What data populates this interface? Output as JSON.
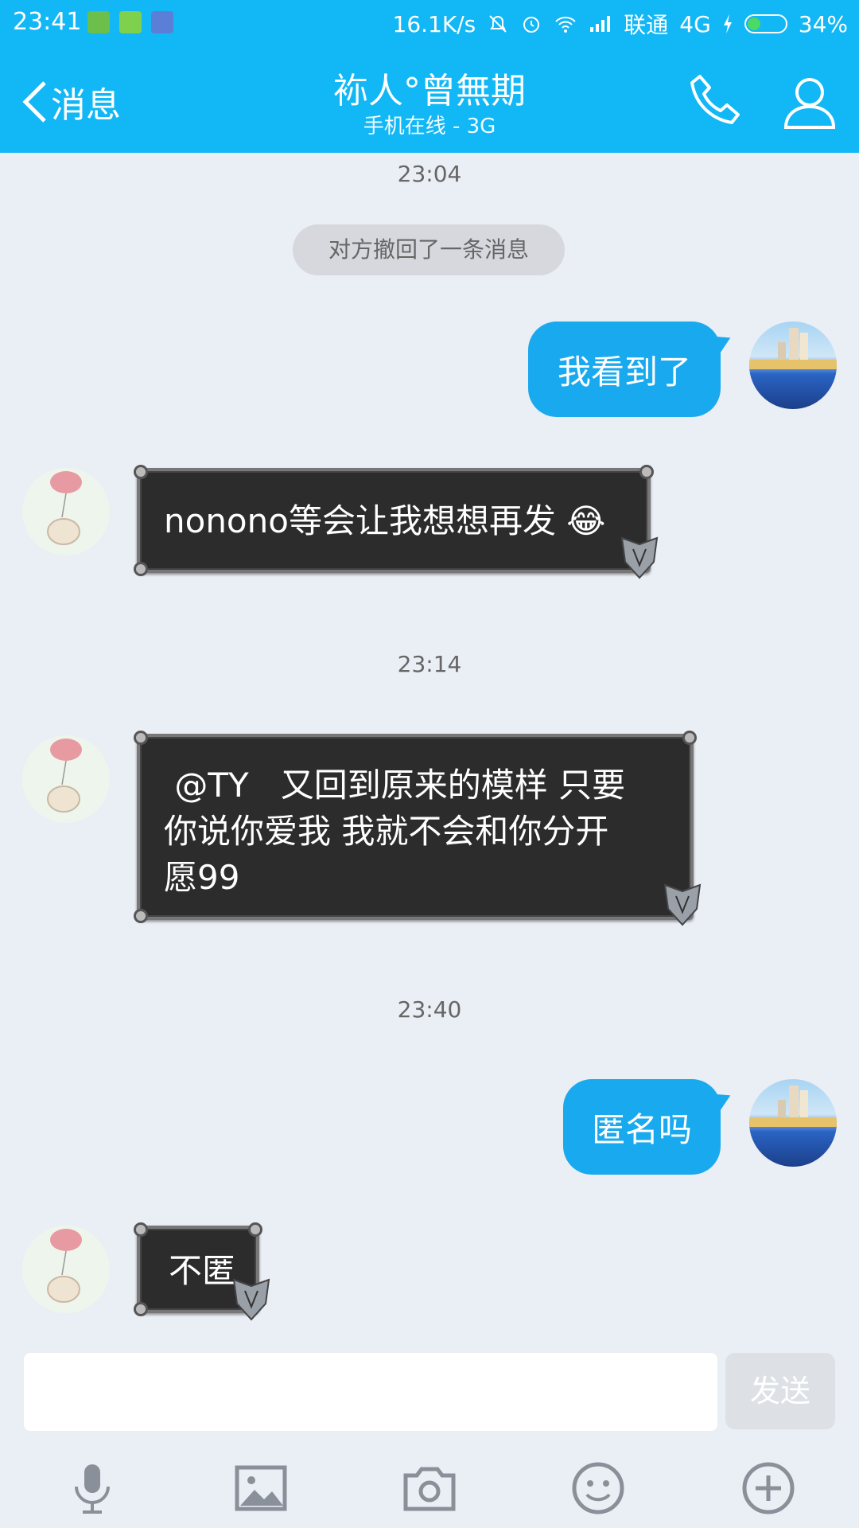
{
  "status": {
    "time": "23:41",
    "net_speed": "16.1K/s",
    "carrier": "联通",
    "network": "4G",
    "battery": "34%",
    "battery_level": 0.34
  },
  "header": {
    "back_label": "消息",
    "title": "袮人°曾無期",
    "subtitle": "手机在线 - 3G"
  },
  "chat": {
    "timestamps": [
      "23:04",
      "23:14",
      "23:40"
    ],
    "system_notice": "对方撤回了一条消息",
    "messages": [
      {
        "side": "out",
        "text": "我看到了"
      },
      {
        "side": "in",
        "text": "nonono等会让我想想再发 😂"
      },
      {
        "side": "in",
        "text": " @TY   又回到原来的模样 只要\n你说你爱我 我就不会和你分开\n愿99"
      },
      {
        "side": "out",
        "text": "匿名吗"
      },
      {
        "side": "in",
        "text": "不匿"
      }
    ]
  },
  "input": {
    "placeholder": "",
    "send_label": "发送"
  },
  "toolbar": {
    "icons": [
      "microphone-icon",
      "image-icon",
      "camera-icon",
      "emoji-icon",
      "plus-icon"
    ]
  },
  "colors": {
    "header": "#12b7f5",
    "bubble_out": "#19a9ee",
    "bubble_in": "#2c2c2c",
    "background": "#eaeef5"
  }
}
